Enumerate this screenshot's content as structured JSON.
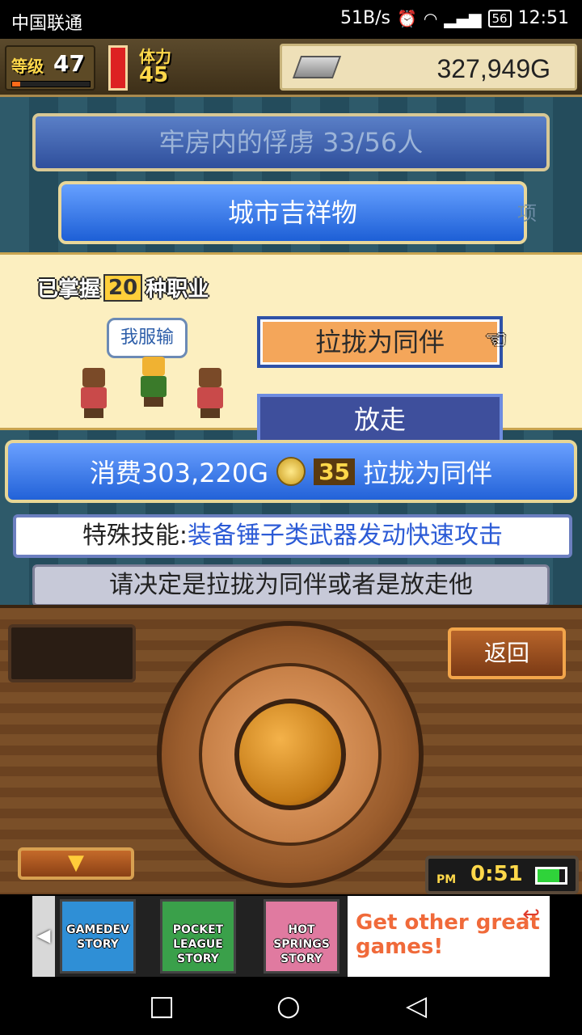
{
  "status_bar": {
    "carrier": "中国联通",
    "net_speed": "51B/s",
    "battery": "56",
    "time": "12:51"
  },
  "hud": {
    "level_label": "等级",
    "level_value": "47",
    "level_progress": 0.1,
    "stamina_label": "体力",
    "stamina_value": "45",
    "money": "327,949G"
  },
  "background": {
    "panel_title": "牢房内的俘虏  33/56人",
    "panel_sub": "城市吉祥物",
    "dim_right": "项"
  },
  "dialog": {
    "mastered_prefix": "已掌握",
    "mastered_count": "20",
    "mastered_suffix": "种职业",
    "speech": "我服输",
    "recruit_button": "拉拢为同伴",
    "release_button": "放走"
  },
  "cost": {
    "prefix": "消费303,220G",
    "coin_count": "35",
    "suffix": "拉拢为同伴"
  },
  "skill": {
    "label": "特殊技能:",
    "value": "装备锤子类武器发动快速攻击"
  },
  "prompt": "请决定是拉拢为同伴或者是放走他",
  "controller": {
    "back_button": "返回",
    "down_button": "▼",
    "clock_ampm": "PM",
    "clock_time": "0:51",
    "clock_battery": 0.8
  },
  "ad": {
    "games": [
      "GAMEDEV STORY",
      "POCKET LEAGUE STORY",
      "HOT SPRINGS STORY"
    ],
    "cta": "Get other great games!"
  },
  "colors": {
    "blue_panel": "#2262d8",
    "dialog_bg": "#fcefc0",
    "recruit_btn": "#f4a65a",
    "release_btn": "#3e4f9c",
    "skill_text": "#2c5bd6"
  }
}
